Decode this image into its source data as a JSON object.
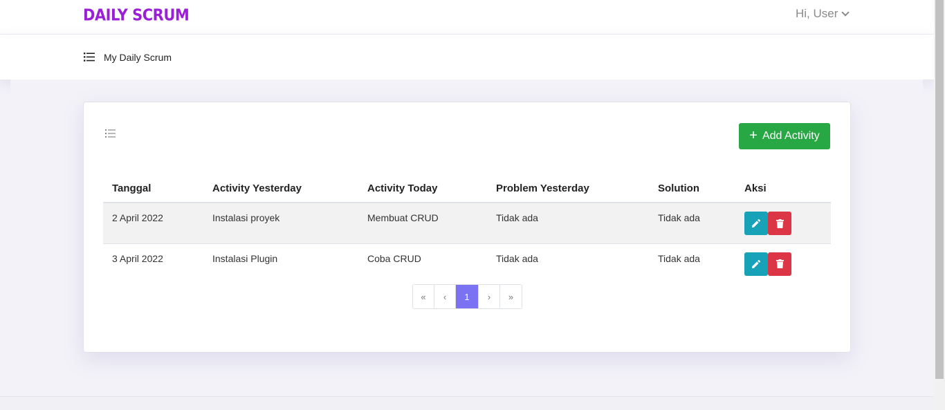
{
  "header": {
    "logo": "DAILY SCRUM",
    "user_greeting": "Hi, User"
  },
  "subnav": {
    "menu_icon": "list-icon",
    "title": "My Daily Scrum"
  },
  "card": {
    "list_icon": "list-icon",
    "add_button_label": "Add Activity",
    "add_button_icon": "plus-icon"
  },
  "table": {
    "columns": [
      "Tanggal",
      "Activity Yesterday",
      "Activity Today",
      "Problem Yesterday",
      "Solution",
      "Aksi"
    ],
    "rows": [
      [
        "2 April 2022",
        "Instalasi proyek",
        "Membuat CRUD",
        "Tidak ada",
        "Tidak ada"
      ],
      [
        "3 April 2022",
        "Instalasi Plugin",
        "Coba CRUD",
        "Tidak ada",
        "Tidak ada"
      ]
    ]
  },
  "pagination": {
    "first": "«",
    "prev": "‹",
    "current": "1",
    "next": "›",
    "last": "»"
  },
  "colors": {
    "brand": "#9b1fd6",
    "add_button": "#28a745",
    "edit_button": "#17a2b8",
    "delete_button": "#dc3545",
    "active_page": "#7b72f3"
  }
}
